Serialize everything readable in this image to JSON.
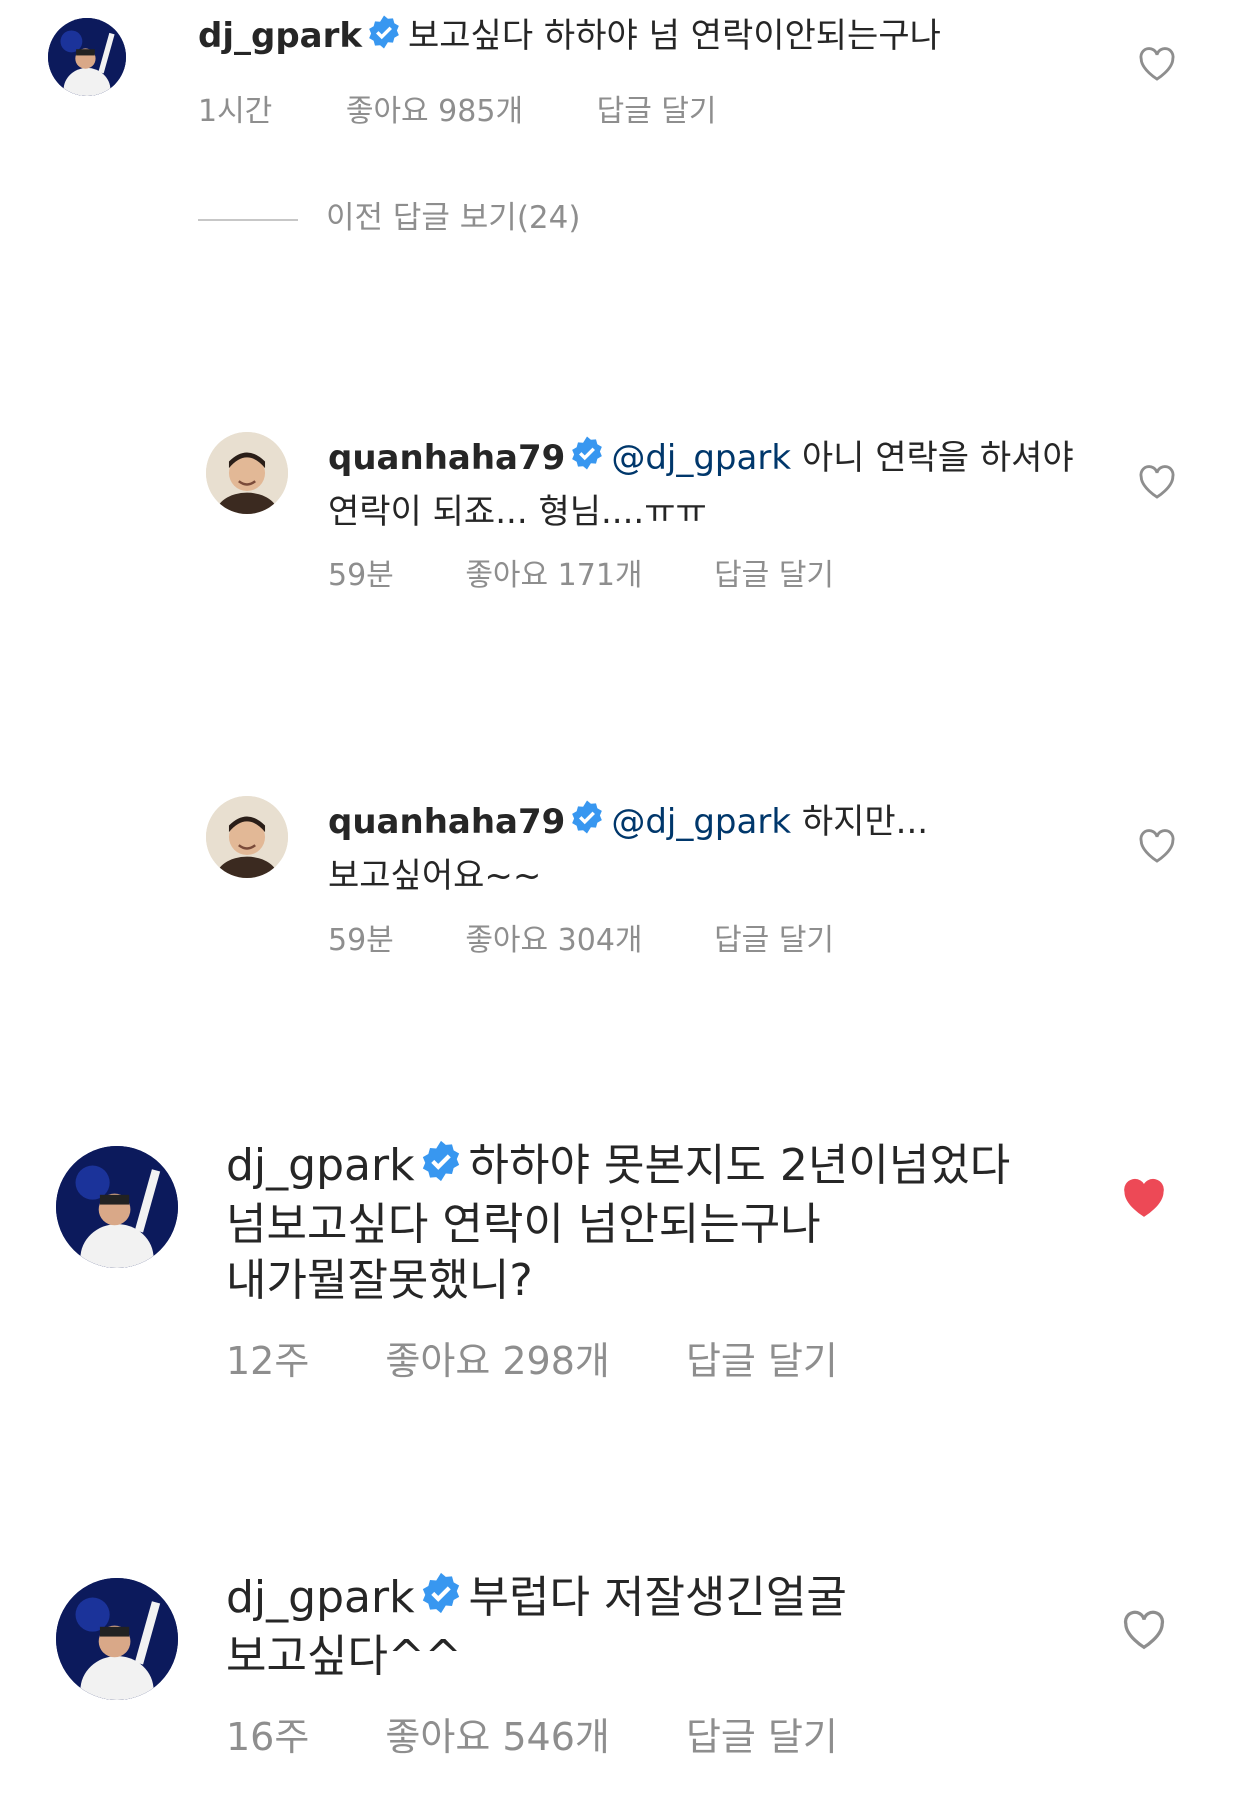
{
  "comments": [
    {
      "username": "dj_gpark",
      "text_line1": "보고싶다 하하야 넘 연락이안되는구나",
      "time": "1시간",
      "likes": "좋아요 985개",
      "reply": "답글 달기",
      "liked": false
    },
    {
      "username": "quanhaha79",
      "mention": "@dj_gpark",
      "text_line1_rest": "아니 연락을 하셔야",
      "text_line2": "연락이 되죠... 형님....ㅠㅠ",
      "time": "59분",
      "likes": "좋아요 171개",
      "reply": "답글 달기",
      "liked": false
    },
    {
      "username": "quanhaha79",
      "mention": "@dj_gpark",
      "text_line1_rest": "하지만...",
      "text_line2": "보고싶어요~~",
      "time": "59분",
      "likes": "좋아요 304개",
      "reply": "답글 달기",
      "liked": false
    },
    {
      "username": "dj_gpark",
      "text_line1": "하하야 못본지도 2년이넘었다",
      "text_line2": "넘보고싶다 연락이 넘안되는구나",
      "text_line3": "내가뭘잘못했니?",
      "time": "12주",
      "likes": "좋아요 298개",
      "reply": "답글 달기",
      "liked": true
    },
    {
      "username": "dj_gpark",
      "text_line1": "부럽다 저잘생긴얼굴",
      "text_line2": "보고싶다^^",
      "time": "16주",
      "likes": "좋아요 546개",
      "reply": "답글 달기",
      "liked": false
    }
  ],
  "view_previous": "이전 답글 보기(24)",
  "colors": {
    "verified": "#3897f0",
    "meta": "#8e8e8e",
    "heart_liked": "#ed4956",
    "heart_outline": "#8e8e8e"
  },
  "icons": [
    "verified-badge-icon",
    "heart-outline-icon",
    "heart-filled-icon"
  ]
}
